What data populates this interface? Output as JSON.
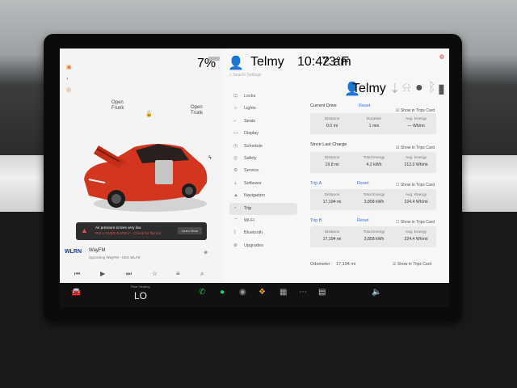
{
  "status": {
    "battery": "7%",
    "user": "Telmy",
    "time": "10:42 am",
    "temp": "73°F"
  },
  "car_view": {
    "labels": [
      {
        "line1": "Open",
        "line2": "Frunk"
      },
      {
        "line1": "Open",
        "line2": "Trunk"
      }
    ]
  },
  "alert": {
    "title": "Air pressure in tires very low",
    "subtitle": "PULL OVER SAFELY - Check for flat tire",
    "button": "Learn More"
  },
  "media": {
    "logo_line1": "WLRN",
    "station": "WayFM",
    "subtitle": "Upcoming WayFM - HD2 WLFE"
  },
  "search": {
    "placeholder": "Search Settings"
  },
  "menu": {
    "items": [
      {
        "label": "Locks",
        "icon": "lock-icon"
      },
      {
        "label": "Lights",
        "icon": "light-icon"
      },
      {
        "label": "Seats",
        "icon": "seat-icon"
      },
      {
        "label": "Display",
        "icon": "display-icon"
      },
      {
        "label": "Schedule",
        "icon": "schedule-icon"
      },
      {
        "label": "Safety",
        "icon": "safety-icon"
      },
      {
        "label": "Service",
        "icon": "wrench-icon"
      },
      {
        "label": "Software",
        "icon": "download-icon"
      },
      {
        "label": "Navigation",
        "icon": "navigation-icon"
      },
      {
        "label": "Trip",
        "icon": "trip-icon"
      },
      {
        "label": "Wi-Fi",
        "icon": "wifi-icon"
      },
      {
        "label": "Bluetooth",
        "icon": "bluetooth-icon"
      },
      {
        "label": "Upgrades",
        "icon": "upgrade-icon"
      }
    ]
  },
  "trip": {
    "user": "Telmy",
    "sections": [
      {
        "title": "Current Drive",
        "reset": "Reset",
        "show": "Show in Trips Card",
        "checked": true,
        "cells": [
          {
            "k": "Distance",
            "v": "0.0 mi"
          },
          {
            "k": "Duration",
            "v": "1 min"
          },
          {
            "k": "Avg. Energy",
            "v": "— Wh/mi"
          }
        ]
      },
      {
        "title": "Since Last Charge",
        "reset": "",
        "show": "Show in Trips Card",
        "checked": true,
        "cells": [
          {
            "k": "Distance",
            "v": "19.8 mi"
          },
          {
            "k": "Total Energy",
            "v": "4.2 kWh"
          },
          {
            "k": "Avg. Energy",
            "v": "212.0 Wh/mi"
          }
        ]
      },
      {
        "title": "Trip A",
        "reset": "Reset",
        "show": "Show in Trips Card",
        "checked": false,
        "cells": [
          {
            "k": "Distance",
            "v": "17,194 mi"
          },
          {
            "k": "Total Energy",
            "v": "3,858 kWh"
          },
          {
            "k": "Avg. Energy",
            "v": "224.4 Wh/mi"
          }
        ]
      },
      {
        "title": "Trip B",
        "reset": "Reset",
        "show": "Show in Trips Card",
        "checked": false,
        "cells": [
          {
            "k": "Distance",
            "v": "17,194 mi"
          },
          {
            "k": "Total Energy",
            "v": "3,858 kWh"
          },
          {
            "k": "Avg. Energy",
            "v": "224.4 Wh/mi"
          }
        ]
      }
    ],
    "odometer": {
      "label": "Odometer :",
      "value": "17,194 mi",
      "show": "Show in Trips Card"
    }
  },
  "taskbar": {
    "climate_label": "Rear Heating",
    "temp": "LO"
  },
  "colors": {
    "accent": "#3a6fd8",
    "car": "#d2361f",
    "alert_text": "#e05050"
  }
}
